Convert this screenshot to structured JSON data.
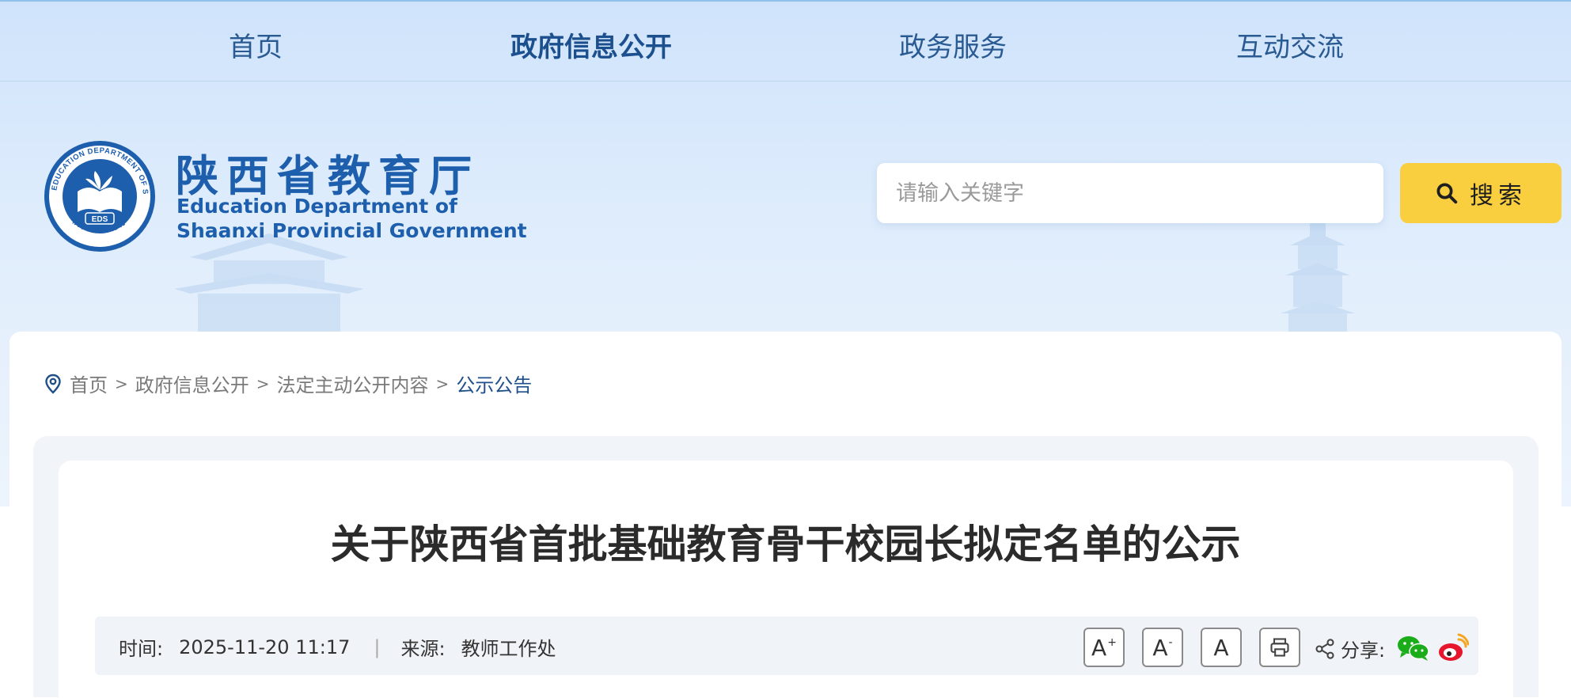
{
  "nav": {
    "items": [
      {
        "label": "首页"
      },
      {
        "label": "政府信息公开"
      },
      {
        "label": "政务服务"
      },
      {
        "label": "互动交流"
      }
    ]
  },
  "logo": {
    "cn_name": "陕西省教育厅",
    "en_line1": "Education Department of",
    "en_line2": "Shaanxi Provincial Government",
    "emblem_text": "EDS",
    "emblem_ring_text": "EDUCATION DEPARTMENT OF SHAANXI",
    "emblem_bottom_text": "陕西省教育厅"
  },
  "search": {
    "placeholder": "请输入关键字",
    "value": "",
    "button_label": "搜索"
  },
  "breadcrumb": {
    "items": [
      "首页",
      "政府信息公开",
      "法定主动公开内容",
      "公示公告"
    ],
    "separator": ">"
  },
  "article": {
    "title": "关于陕西省首批基础教育骨干校园长拟定名单的公示",
    "time_label": "时间:",
    "time_value": "2025-11-20 11:17",
    "divider": "|",
    "source_label": "来源:",
    "source_value": "教师工作处"
  },
  "tools": {
    "font_increase": "A",
    "font_increase_mark": "+",
    "font_decrease": "A",
    "font_decrease_mark": "-",
    "font_reset": "A",
    "share_label": "分享:"
  },
  "colors": {
    "accent_blue": "#1d5fad",
    "search_button": "#f9cf3f",
    "wechat_green": "#1aad19",
    "weibo_red": "#e6162d"
  }
}
